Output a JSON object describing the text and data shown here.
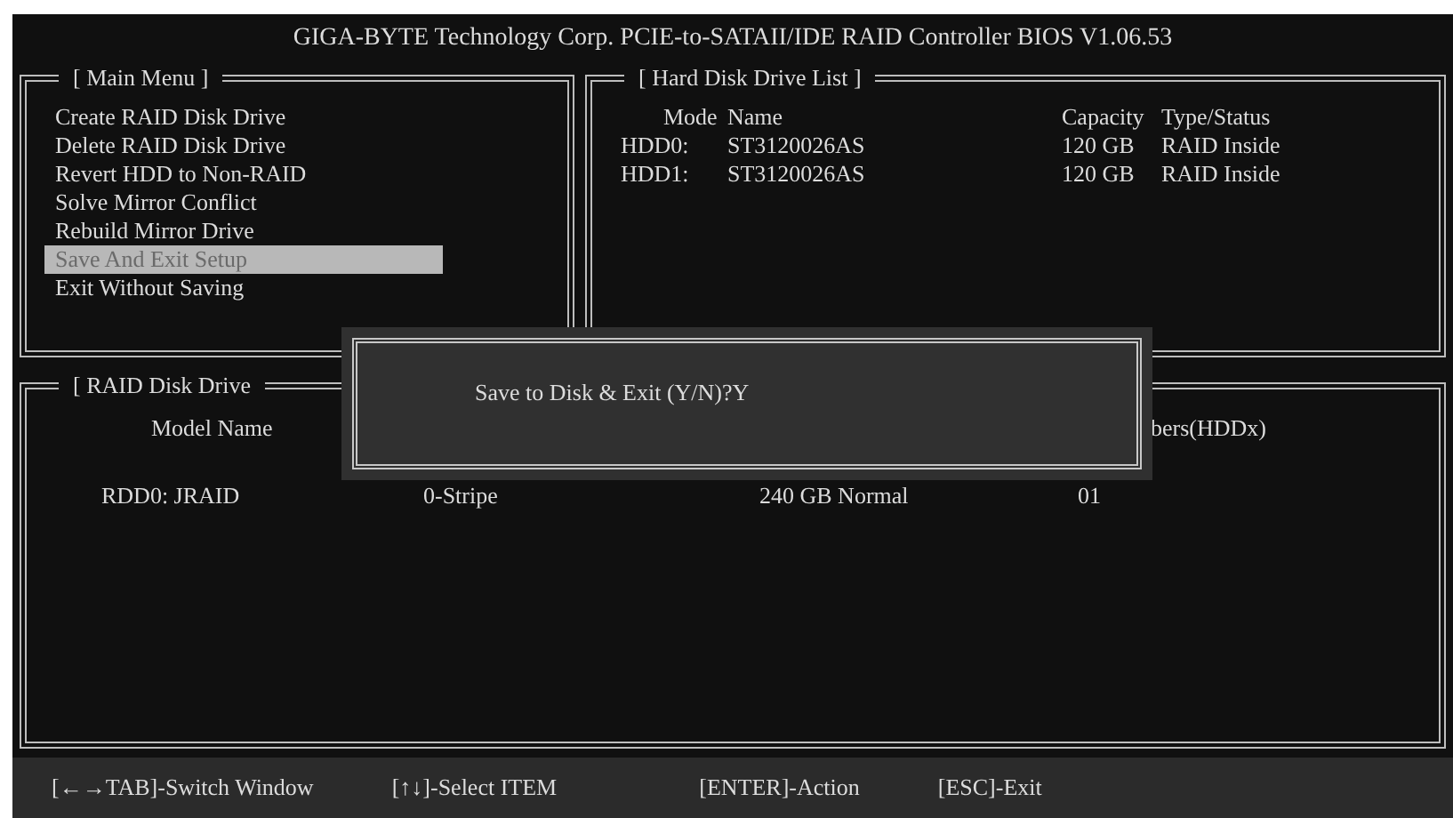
{
  "title": "GIGA-BYTE Technology Corp. PCIE-to-SATAII/IDE RAID Controller BIOS V1.06.53",
  "main_menu": {
    "title": "[ Main Menu ]",
    "items": [
      {
        "label": "Create RAID Disk Drive",
        "selected": false
      },
      {
        "label": "Delete RAID Disk Drive",
        "selected": false
      },
      {
        "label": "Revert HDD to Non-RAID",
        "selected": false
      },
      {
        "label": "Solve Mirror Conflict",
        "selected": false
      },
      {
        "label": "Rebuild Mirror Drive",
        "selected": false
      },
      {
        "label": "Save And Exit Setup",
        "selected": true
      },
      {
        "label": "Exit Without Saving",
        "selected": false
      }
    ]
  },
  "hdd_list": {
    "title": "[ Hard Disk Drive List ]",
    "columns": [
      "Mode",
      "Name",
      "Capacity",
      "Type/Status"
    ],
    "rows": [
      [
        "HDD0:",
        "ST3120026AS",
        "120 GB",
        "RAID Inside"
      ],
      [
        "HDD1:",
        "ST3120026AS",
        "120 GB",
        "RAID Inside"
      ]
    ]
  },
  "raid_list": {
    "title": "[ RAID Disk Drive",
    "columns": [
      "Model Name",
      "bers(HDDx)"
    ],
    "rows": [
      [
        "RDD0: JRAID",
        "0-Stripe",
        "240 GB Normal",
        "01"
      ]
    ]
  },
  "dialog": {
    "message": "Save to Disk & Exit (Y/N)?Y"
  },
  "footer": [
    "[←→TAB]-Switch Window",
    "[↑↓]-Select ITEM",
    "[ENTER]-Action",
    "[ESC]-Exit"
  ]
}
